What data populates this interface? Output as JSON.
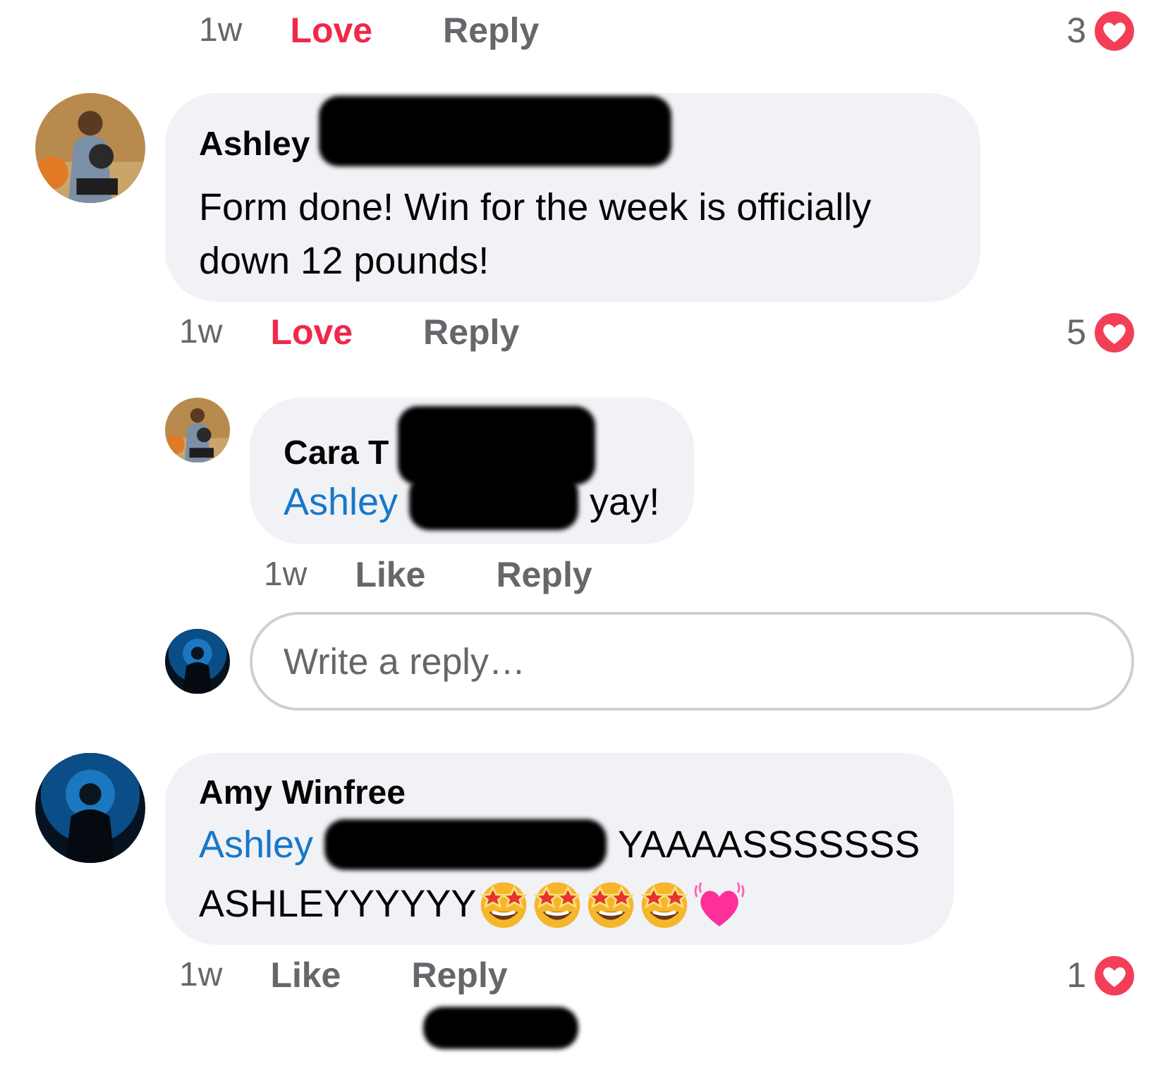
{
  "top_actions": {
    "time": "1w",
    "reaction": "Love",
    "reacted": true,
    "reply": "Reply",
    "count": "3"
  },
  "comments": [
    {
      "kind": "comment",
      "author": "Ashley",
      "author_redacted": true,
      "text": "Form done! Win for the week is officially down 12 pounds!",
      "actions": {
        "time": "1w",
        "reaction": "Love",
        "reacted": true,
        "reply": "Reply",
        "count": "5"
      }
    },
    {
      "kind": "reply",
      "author": "Cara T",
      "author_redacted": true,
      "mention": "Ashley",
      "mention_redacted": true,
      "text": "yay!",
      "actions": {
        "time": "1w",
        "reaction": "Like",
        "reacted": false,
        "reply": "Reply"
      }
    },
    {
      "kind": "field",
      "avatar": {
        "kind": "dark"
      },
      "placeholder": "Write a reply…"
    },
    {
      "kind": "comment",
      "avatar": {
        "kind": "dark"
      },
      "author": "Amy Winfree",
      "mention": "Ashley",
      "mention_redacted": true,
      "text": "YAAAASSSSSSS",
      "text_2": "ASHLEYYYYYY",
      "emojis": [
        {
          "kind": "star_struck"
        },
        {
          "kind": "star_struck"
        },
        {
          "kind": "star_struck"
        },
        {
          "kind": "star_struck"
        },
        {
          "kind": "heart"
        }
      ],
      "actions": {
        "time": "1w",
        "reaction": "Like",
        "reacted": false,
        "reply": "Reply",
        "count": "1"
      }
    }
  ],
  "trailing_redaction": true
}
